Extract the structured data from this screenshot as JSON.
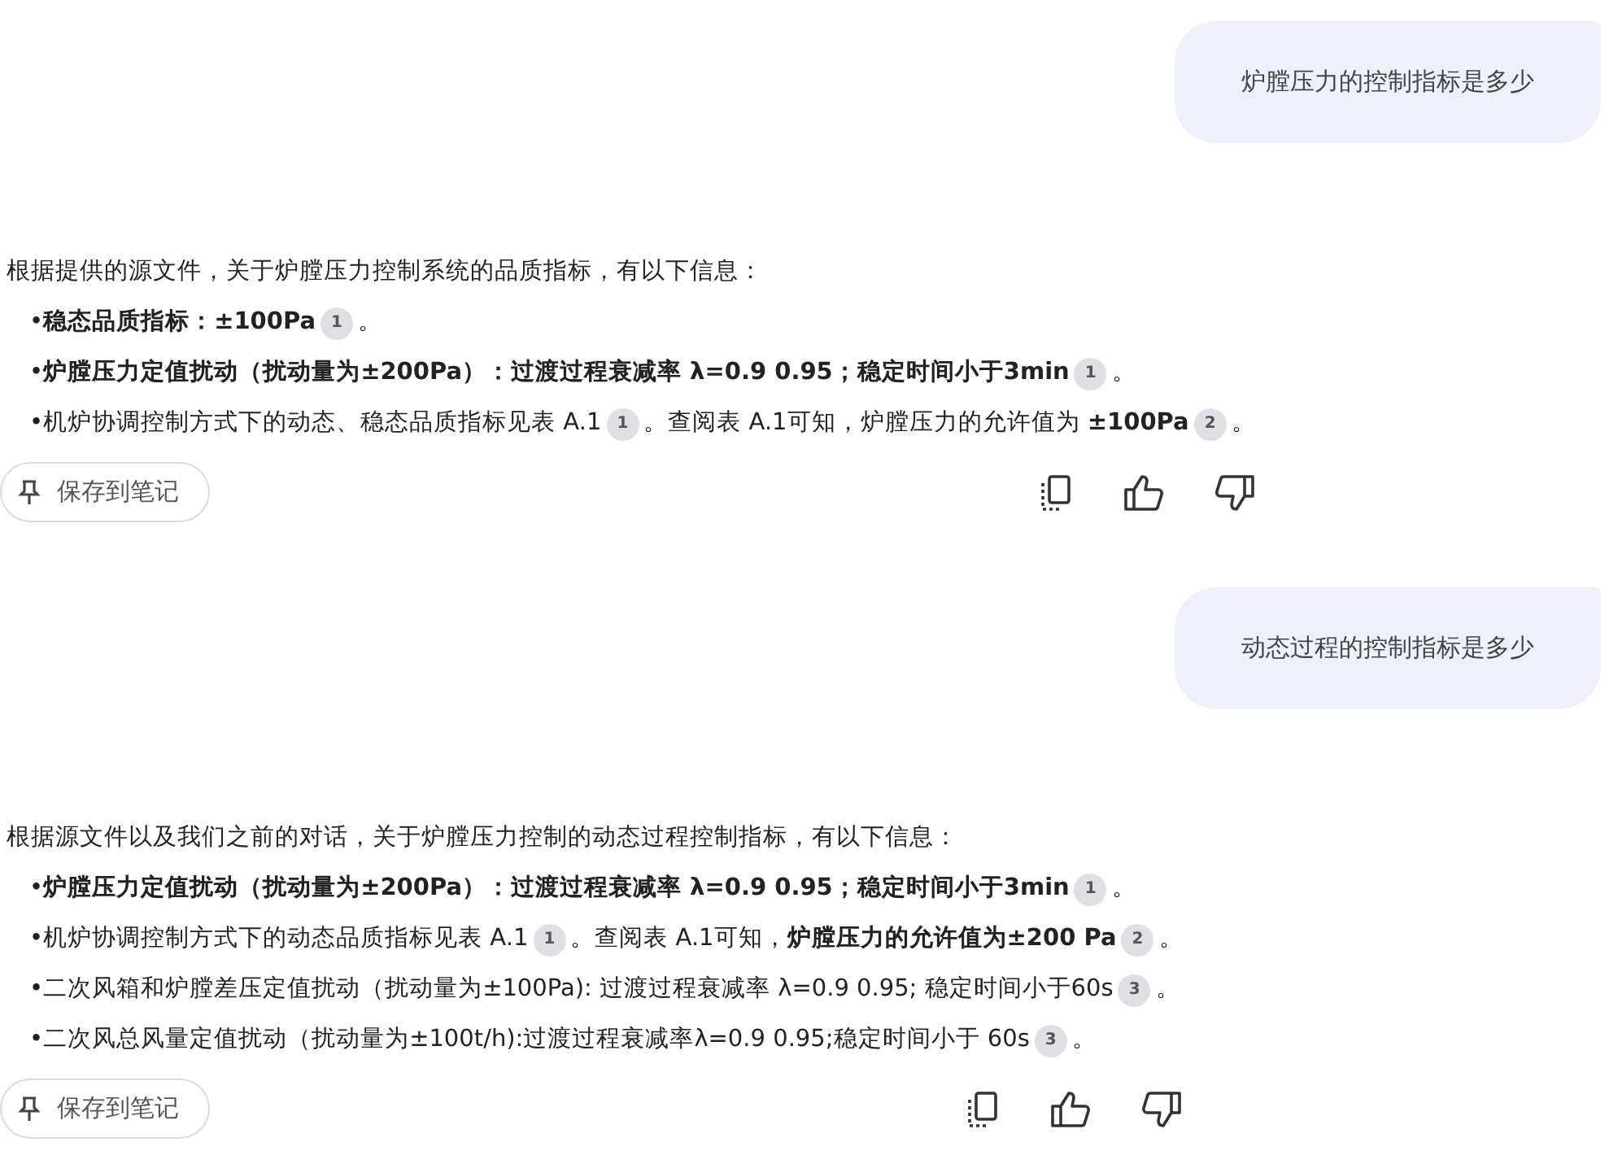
{
  "messages": [
    {
      "kind": "user",
      "text": "炉膛压力的控制指标是多少"
    },
    {
      "kind": "answer",
      "marker": "•",
      "intro": "根据提供的源文件，关于炉膛压力控制系统的品质指标，有以下信息：",
      "bullets": [
        [
          {
            "text": "**稳态品质指标：±100Pa**"
          },
          {
            "citation": "1"
          },
          {
            "text": "。"
          }
        ],
        [
          {
            "text": "**炉膛压力定值扰动（扰动量为±200Pa）：过渡过程衰减率 λ=0.9 0.95；稳定时间小于3min**"
          },
          {
            "citation": "1"
          },
          {
            "text": "。"
          }
        ],
        [
          {
            "text": "机炉协调控制方式下的动态、稳态品质指标见表 A.1"
          },
          {
            "citation": "1"
          },
          {
            "text": "。查阅表 A.1可知，炉膛压力的允许值为 **±100Pa**"
          },
          {
            "citation": "2"
          },
          {
            "text": "。"
          }
        ]
      ],
      "save_label": "保存到笔记"
    },
    {
      "kind": "user",
      "text": "动态过程的控制指标是多少"
    },
    {
      "kind": "answer",
      "marker": "•",
      "intro": "根据源文件以及我们之前的对话，关于炉膛压力控制的动态过程控制指标，有以下信息：",
      "bullets": [
        [
          {
            "text": "**炉膛压力定值扰动（扰动量为±200Pa）：过渡过程衰减率 λ=0.9 0.95；稳定时间小于3min**"
          },
          {
            "citation": "1"
          },
          {
            "text": "。"
          }
        ],
        [
          {
            "text": "机炉协调控制方式下的动态品质指标见表 A.1"
          },
          {
            "citation": "1"
          },
          {
            "text": "。查阅表 A.1可知，**炉膛压力的允许值为±200 Pa**"
          },
          {
            "citation": "2"
          },
          {
            "text": "。"
          }
        ],
        [
          {
            "text": "二次风箱和炉膛差压定值扰动（扰动量为±100Pa): 过渡过程衰减率 λ=0.9 0.95; 稳定时间小于60s"
          },
          {
            "citation": "3"
          },
          {
            "text": "。"
          }
        ],
        [
          {
            "text": "二次风总风量定值扰动（扰动量为±100t/h):过渡过程衰减率λ=0.9 0.95;稳定时间小于 60s"
          },
          {
            "citation": "3"
          },
          {
            "text": "。"
          }
        ]
      ],
      "save_label": "保存到笔记"
    }
  ]
}
